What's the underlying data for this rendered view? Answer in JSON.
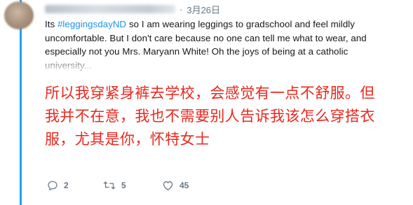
{
  "tweet": {
    "date": "3月26日",
    "separator": "·",
    "text_prefix": "Its ",
    "hashtag": "#leggingsdayND",
    "text_line1_rest": " so I am wearing leggings to gradschool and feel mildly",
    "text_line2": "uncomfortable.  But I don't care because no one can tell me what to wear, and",
    "text_line3": "especially  not you Mrs. Maryann White! Oh the joys of being at a catholic",
    "text_line4": "university..."
  },
  "translation": {
    "line1": "所以我穿紧身裤去学校，会感觉有一点不舒服。但",
    "line2": "我并不在意，我也不需要别人告诉我该怎么穿搭衣",
    "line3": "服，尤其是你，怀特女士"
  },
  "actions": {
    "reply_count": "2",
    "retweet_count": "5",
    "like_count": "45"
  },
  "icons": {
    "reply": "reply-icon",
    "retweet": "retweet-icon",
    "like": "heart-icon"
  },
  "colors": {
    "accent": "#1da1f2",
    "hashtag": "#1b95e0",
    "translation": "#e8281e",
    "muted": "#657786",
    "text": "#14171a"
  }
}
